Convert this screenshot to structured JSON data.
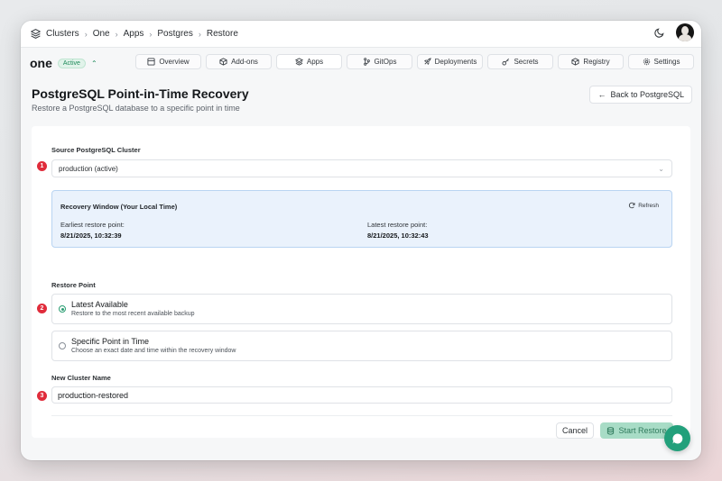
{
  "breadcrumb": [
    "Clusters",
    "One",
    "Apps",
    "Postgres",
    "Restore"
  ],
  "project": {
    "name": "one",
    "status": "Active"
  },
  "tabs": [
    {
      "label": "Overview",
      "icon": "overview-icon",
      "active": false
    },
    {
      "label": "Add-ons",
      "icon": "box-icon",
      "active": false
    },
    {
      "label": "Apps",
      "icon": "layers-icon",
      "active": true
    },
    {
      "label": "GitOps",
      "icon": "git-branch-icon",
      "active": false
    },
    {
      "label": "Deployments",
      "icon": "rocket-icon",
      "active": false
    },
    {
      "label": "Secrets",
      "icon": "key-icon",
      "active": false
    },
    {
      "label": "Registry",
      "icon": "cube-icon",
      "active": false
    },
    {
      "label": "Settings",
      "icon": "gear-icon",
      "active": false
    }
  ],
  "page": {
    "title": "PostgreSQL Point-in-Time Recovery",
    "subtitle": "Restore a PostgreSQL database to a specific point in time",
    "back_label": "Back to PostgreSQL"
  },
  "form": {
    "source_label": "Source PostgreSQL Cluster",
    "source_value": "production (active)",
    "recovery_window": {
      "title": "Recovery Window (Your Local Time)",
      "refresh_label": "Refresh",
      "earliest_label": "Earliest restore point:",
      "earliest_value": "8/21/2025, 10:32:39",
      "latest_label": "Latest restore point:",
      "latest_value": "8/21/2025, 10:32:43"
    },
    "restore_point_label": "Restore Point",
    "options": [
      {
        "title": "Latest Available",
        "desc": "Restore to the most recent available backup",
        "selected": true
      },
      {
        "title": "Specific Point in Time",
        "desc": "Choose an exact date and time within the recovery window",
        "selected": false
      }
    ],
    "new_name_label": "New Cluster Name",
    "new_name_value": "production-restored",
    "cancel_label": "Cancel",
    "start_label": "Start Restore"
  },
  "steps": [
    "1",
    "2",
    "3",
    "4"
  ],
  "colors": {
    "accent": "#22a07b",
    "step_badge": "#e02c3b",
    "info_bg": "#eaf2fc"
  }
}
